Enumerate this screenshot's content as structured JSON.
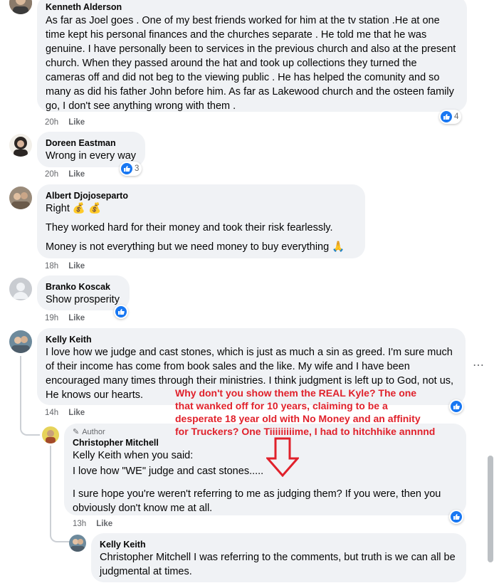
{
  "comments": [
    {
      "name": "Kenneth Alderson",
      "paragraphs": [
        "As far as Joel goes . One of my best friends worked for him at the tv station .He at one time kept his personal finances and the churches separate . He told me that he was genuine. I have personally been to services in the previous church and also at the present church. When they passed around the hat and took up collections they turned the cameras off and did not beg to the viewing public . He has helped the comunity and so many as did his father John before him. As far as Lakewood church and the osteen family go, I don't see anything wrong with them ."
      ],
      "time": "20h",
      "like": "Like",
      "reactions": "4"
    },
    {
      "name": "Doreen Eastman",
      "paragraphs": [
        "Wrong in every way"
      ],
      "time": "20h",
      "like": "Like",
      "reactions": "3"
    },
    {
      "name": "Albert Djojoseparto",
      "paragraphs": [
        "Right 💰 💰",
        "They worked hard for their money and took their risk fearlessly.",
        "Money is not everything but we need money to buy everything 🙏"
      ],
      "time": "18h",
      "like": "Like"
    },
    {
      "name": "Branko Koscak",
      "paragraphs": [
        "Show prosperity"
      ],
      "time": "19h",
      "like": "Like"
    },
    {
      "name": "Kelly Keith",
      "paragraphs": [
        "I love how we judge and cast stones, which is just as much a sin as greed. I'm sure much of their income has come from book sales and the like. My wife and I have been encouraged many times through their ministries. I think judgment is left up to God, not us, He knows our hearts."
      ],
      "time": "14h",
      "like": "Like",
      "more": "⋯"
    }
  ],
  "replies": [
    {
      "author_tag": "Author",
      "name": "Christopher Mitchell",
      "mention": "Kelly Keith",
      "mention_rest": " when you said:",
      "quote": "I love how \"WE\" judge and cast stones.....",
      "body": "I sure hope you're weren't referring to me as judging them? If you were, then you obviously don't know me at all.",
      "time": "13h",
      "like": "Like"
    },
    {
      "name": "Kelly Keith",
      "mention": "Christopher Mitchell",
      "body": " I was referring to the comments, but truth is we can all be judgmental at times."
    }
  ],
  "annotation": {
    "lines": [
      "Why don't you show them the REAL Kyle? The one",
      "that wanked off for 10 years, claiming to be a",
      "desperate 18 year old with No Money and an affinity",
      "for Truckers? One Tiiiiiiiiime, I had to hitchhike annnnd"
    ],
    "color": "#e0212b"
  },
  "colors": {
    "bubble": "#f0f2f5",
    "like_blue": "#1877f2",
    "meta_gray": "#65676b"
  },
  "icons": [
    "like-icon",
    "pencil-icon",
    "down-arrow-icon",
    "more-icon"
  ]
}
